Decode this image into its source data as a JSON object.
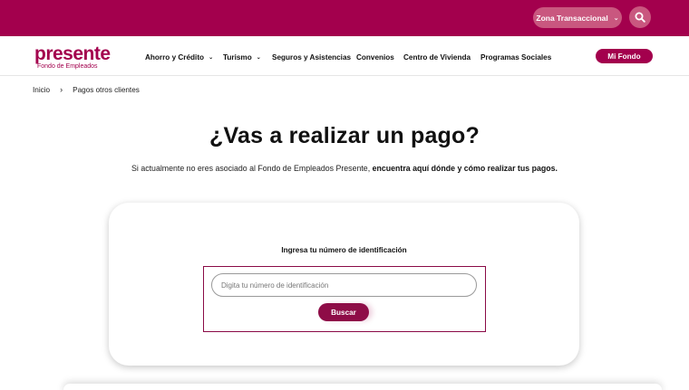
{
  "colors": {
    "brand": "#a3004d",
    "brand_light": "#c9577f",
    "button": "#8e0c47"
  },
  "topbar": {
    "zone_label": "Zona Transaccional",
    "search_icon": "search-icon"
  },
  "logo": {
    "word": "presente",
    "sub": "Fondo de Empleados"
  },
  "nav": {
    "items": [
      {
        "label": "Ahorro y Crédito",
        "has_dropdown": true
      },
      {
        "label": "Turismo",
        "has_dropdown": true
      },
      {
        "label": "Seguros y Asistencias",
        "has_dropdown": false
      },
      {
        "label": "Convenios",
        "has_dropdown": false
      },
      {
        "label": "Centro de Vivienda",
        "has_dropdown": false
      },
      {
        "label": "Programas Sociales",
        "has_dropdown": false
      }
    ],
    "mi_fondo": "Mi Fondo"
  },
  "breadcrumb": {
    "home": "Inicio",
    "separator": "›",
    "current": "Pagos otros clientes"
  },
  "main": {
    "title": "¿Vas a realizar un pago?",
    "subtitle_plain": "Si actualmente no eres asociado al Fondo de Empleados Presente, ",
    "subtitle_bold": "encuentra aquí dónde y cómo realizar tus pagos."
  },
  "form": {
    "label": "Ingresa tu número de identificación",
    "placeholder": "Digita tu número de identificación",
    "value": "",
    "button": "Buscar"
  }
}
